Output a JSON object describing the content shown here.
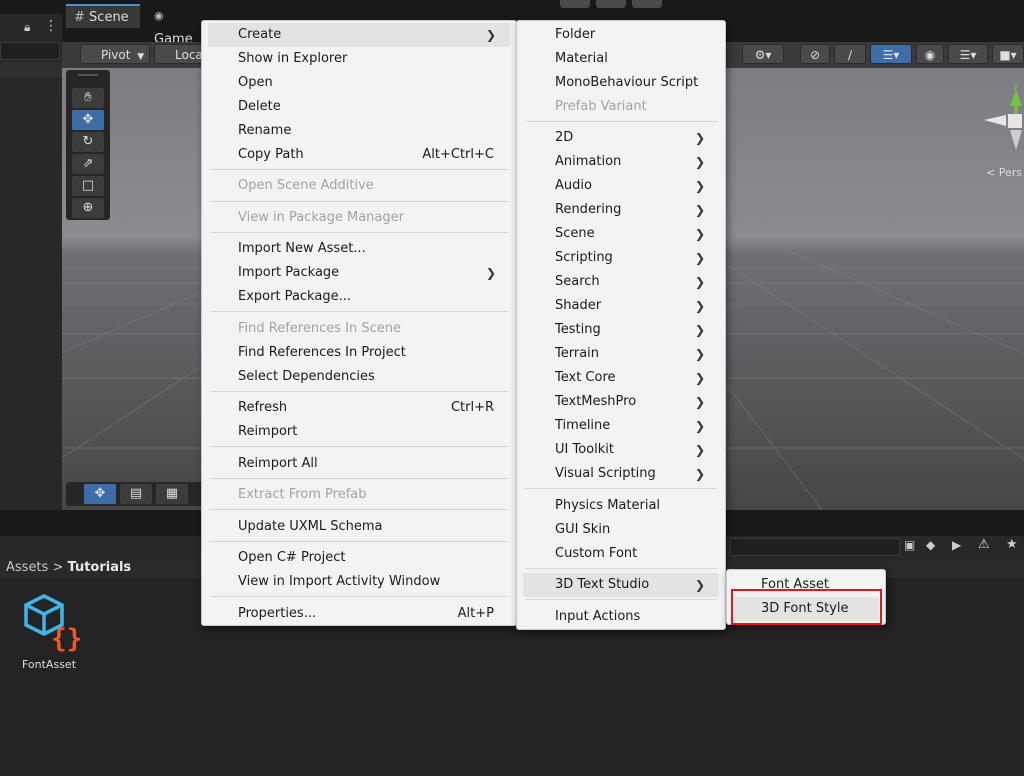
{
  "editor": {
    "tabs": {
      "scene": "Scene",
      "game": "Game"
    },
    "toolbar": {
      "pivot": "Pivot",
      "local": "Loca"
    },
    "gizmo": {
      "axis_y": "y",
      "persp": "< Pers"
    }
  },
  "project": {
    "breadcrumb": {
      "root": "Assets",
      "separator": ">",
      "current": "Tutorials"
    },
    "assets": [
      {
        "name": "FontAsset"
      }
    ]
  },
  "context_menu": {
    "items": [
      {
        "label": "Create",
        "submenu": true
      },
      {
        "label": "Show in Explorer"
      },
      {
        "label": "Open"
      },
      {
        "label": "Delete"
      },
      {
        "label": "Rename"
      },
      {
        "label": "Copy Path",
        "shortcut": "Alt+Ctrl+C"
      },
      {
        "label": "Open Scene Additive",
        "disabled": true
      },
      {
        "label": "View in Package Manager",
        "disabled": true
      },
      {
        "label": "Import New Asset..."
      },
      {
        "label": "Import Package",
        "submenu": true
      },
      {
        "label": "Export Package..."
      },
      {
        "label": "Find References In Scene",
        "disabled": true
      },
      {
        "label": "Find References In Project"
      },
      {
        "label": "Select Dependencies"
      },
      {
        "label": "Refresh",
        "shortcut": "Ctrl+R"
      },
      {
        "label": "Reimport"
      },
      {
        "label": "Reimport All"
      },
      {
        "label": "Extract From Prefab",
        "disabled": true
      },
      {
        "label": "Update UXML Schema"
      },
      {
        "label": "Open C# Project"
      },
      {
        "label": "View in Import Activity Window"
      },
      {
        "label": "Properties...",
        "shortcut": "Alt+P"
      }
    ]
  },
  "create_menu": {
    "items": [
      {
        "label": "Folder"
      },
      {
        "label": "Material"
      },
      {
        "label": "MonoBehaviour Script"
      },
      {
        "label": "Prefab Variant",
        "disabled": true
      },
      {
        "label": "2D",
        "submenu": true
      },
      {
        "label": "Animation",
        "submenu": true
      },
      {
        "label": "Audio",
        "submenu": true
      },
      {
        "label": "Rendering",
        "submenu": true
      },
      {
        "label": "Scene",
        "submenu": true
      },
      {
        "label": "Scripting",
        "submenu": true
      },
      {
        "label": "Search",
        "submenu": true
      },
      {
        "label": "Shader",
        "submenu": true
      },
      {
        "label": "Testing",
        "submenu": true
      },
      {
        "label": "Terrain",
        "submenu": true
      },
      {
        "label": "Text Core",
        "submenu": true
      },
      {
        "label": "TextMeshPro",
        "submenu": true
      },
      {
        "label": "Timeline",
        "submenu": true
      },
      {
        "label": "UI Toolkit",
        "submenu": true
      },
      {
        "label": "Visual Scripting",
        "submenu": true
      },
      {
        "label": "Physics Material"
      },
      {
        "label": "GUI Skin"
      },
      {
        "label": "Custom Font"
      },
      {
        "label": "3D Text Studio",
        "submenu": true
      },
      {
        "label": "Input Actions"
      }
    ]
  },
  "studio_menu": {
    "items": [
      {
        "label": "Font Asset"
      },
      {
        "label": "3D Font Style"
      }
    ]
  },
  "colors": {
    "highlight": "#e0191c",
    "accent": "#3d6ea8"
  }
}
